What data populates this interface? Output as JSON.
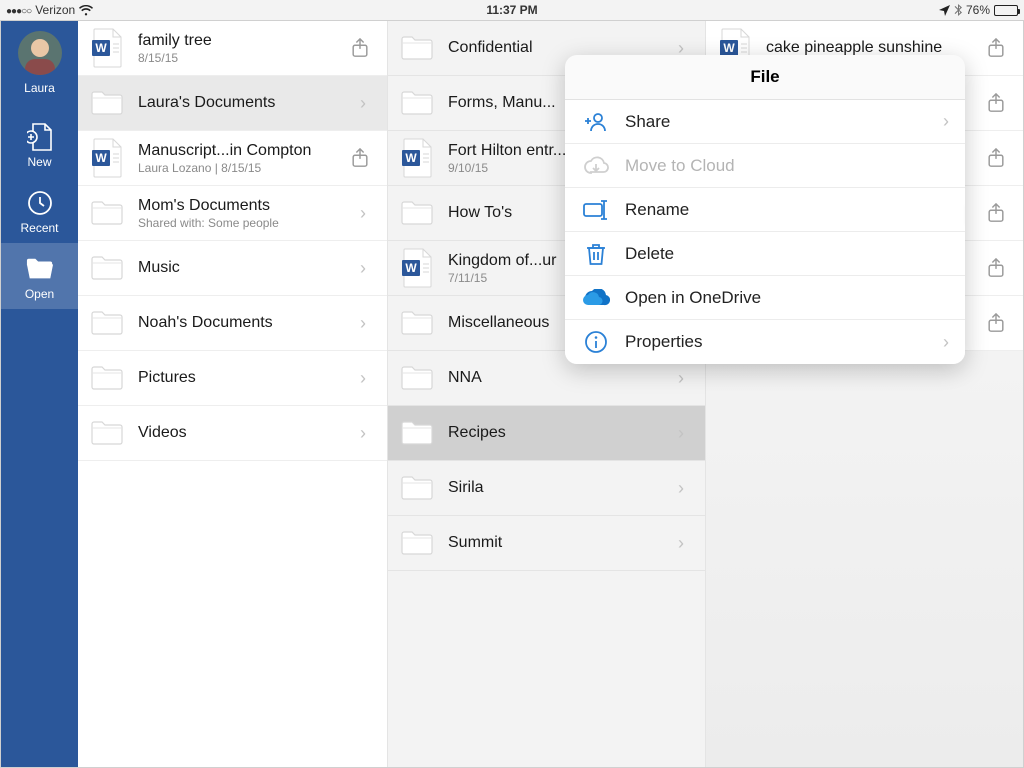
{
  "statusbar": {
    "carrier": "Verizon",
    "time": "11:37 PM",
    "battery": "76%"
  },
  "sidebar": {
    "user": "Laura",
    "items": [
      {
        "label": "New"
      },
      {
        "label": "Recent"
      },
      {
        "label": "Open"
      }
    ]
  },
  "col1": [
    {
      "type": "doc",
      "title": "family tree",
      "sub": "8/15/15",
      "action": "share"
    },
    {
      "type": "folder",
      "title": "Laura's Documents",
      "action": "chev",
      "selected": true
    },
    {
      "type": "doc",
      "title": "Manuscript...in Compton",
      "sub": "Laura Lozano | 8/15/15",
      "action": "share"
    },
    {
      "type": "folder",
      "title": "Mom's Documents",
      "sub": "Shared with: Some people",
      "action": "chev"
    },
    {
      "type": "folder",
      "title": "Music",
      "action": "chev"
    },
    {
      "type": "folder",
      "title": "Noah's Documents",
      "action": "chev"
    },
    {
      "type": "folder",
      "title": "Pictures",
      "action": "chev"
    },
    {
      "type": "folder",
      "title": "Videos",
      "action": "chev"
    }
  ],
  "col2": [
    {
      "type": "folder",
      "title": "Confidential",
      "action": "chev"
    },
    {
      "type": "folder",
      "title": "Forms, Manu..."
    },
    {
      "type": "doc",
      "title": "Fort Hilton entr...",
      "sub": "9/10/15"
    },
    {
      "type": "folder",
      "title": "How To's"
    },
    {
      "type": "doc",
      "title": "Kingdom of...ur",
      "sub": "7/11/15"
    },
    {
      "type": "folder",
      "title": "Miscellaneous"
    },
    {
      "type": "folder",
      "title": "NNA",
      "action": "chev"
    },
    {
      "type": "folder",
      "title": "Recipes",
      "action": "chev",
      "selected": true
    },
    {
      "type": "folder",
      "title": "Sirila",
      "action": "chev"
    },
    {
      "type": "folder",
      "title": "Summit",
      "action": "chev"
    }
  ],
  "col3": [
    {
      "type": "doc",
      "title": "cake pineapple sunshine",
      "action": "share"
    },
    {
      "type": "blank",
      "action": "share"
    },
    {
      "type": "blank",
      "action": "share"
    },
    {
      "type": "blank",
      "action": "share"
    },
    {
      "type": "blank",
      "action": "share"
    },
    {
      "type": "blank",
      "action": "share"
    }
  ],
  "popover": {
    "header": "File",
    "items": [
      {
        "label": "Share",
        "icon": "share-user",
        "chev": true
      },
      {
        "label": "Move to Cloud",
        "icon": "cloud",
        "disabled": true
      },
      {
        "label": "Rename",
        "icon": "rename"
      },
      {
        "label": "Delete",
        "icon": "trash"
      },
      {
        "label": "Open in OneDrive",
        "icon": "onedrive"
      },
      {
        "label": "Properties",
        "icon": "info",
        "chev": true
      }
    ]
  }
}
